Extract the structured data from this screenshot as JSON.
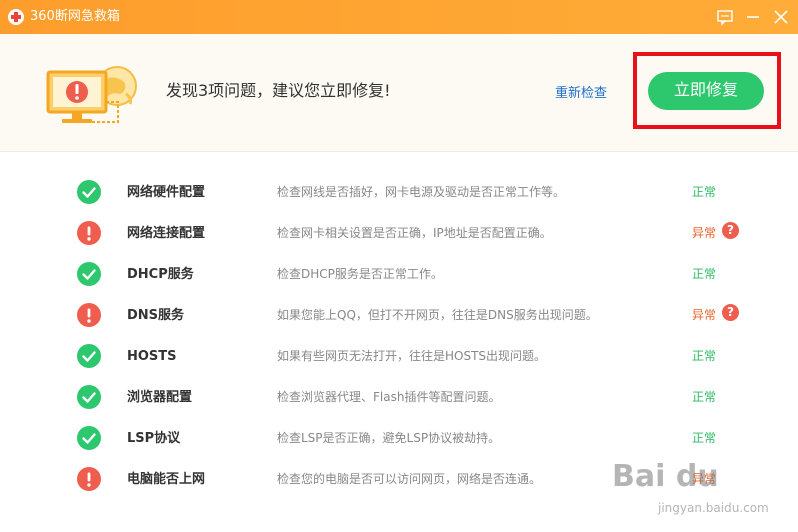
{
  "window": {
    "title": "360断网急救箱"
  },
  "header": {
    "headline": "发现3项问题，建议您立即修复!",
    "recheck_label": "重新检查",
    "fix_label": "立即修复"
  },
  "items": [
    {
      "name": "网络硬件配置",
      "desc": "检查网线是否插好，网卡电源及驱动是否正常工作等。",
      "status": "正常",
      "state": "ok"
    },
    {
      "name": "网络连接配置",
      "desc": "检查网卡相关设置是否正确，IP地址是否配置正确。",
      "status": "异常",
      "state": "err"
    },
    {
      "name": "DHCP服务",
      "desc": "检查DHCP服务是否正常工作。",
      "status": "正常",
      "state": "ok"
    },
    {
      "name": "DNS服务",
      "desc": "如果您能上QQ，但打不开网页，往往是DNS服务出现问题。",
      "status": "异常",
      "state": "err"
    },
    {
      "name": "HOSTS",
      "desc": "如果有些网页无法打开，往往是HOSTS出现问题。",
      "status": "正常",
      "state": "ok"
    },
    {
      "name": "浏览器配置",
      "desc": "检查浏览器代理、Flash插件等配置问题。",
      "status": "正常",
      "state": "ok"
    },
    {
      "name": "LSP协议",
      "desc": "检查LSP是否正确，避免LSP协议被劫持。",
      "status": "正常",
      "state": "ok"
    },
    {
      "name": "电脑能否上网",
      "desc": "检查您的电脑是否可以访问网页，网络是否连通。",
      "status": "异常",
      "state": "err"
    }
  ],
  "help_symbol": "?",
  "watermark": {
    "brand": "Bai du",
    "url": "jingyan.baidu.com"
  },
  "colors": {
    "titlebar": "#fd9d2c",
    "ok": "#2dc76e",
    "error": "#ee5d4d",
    "link": "#1e6fcc",
    "highlight": "#e8101a"
  }
}
